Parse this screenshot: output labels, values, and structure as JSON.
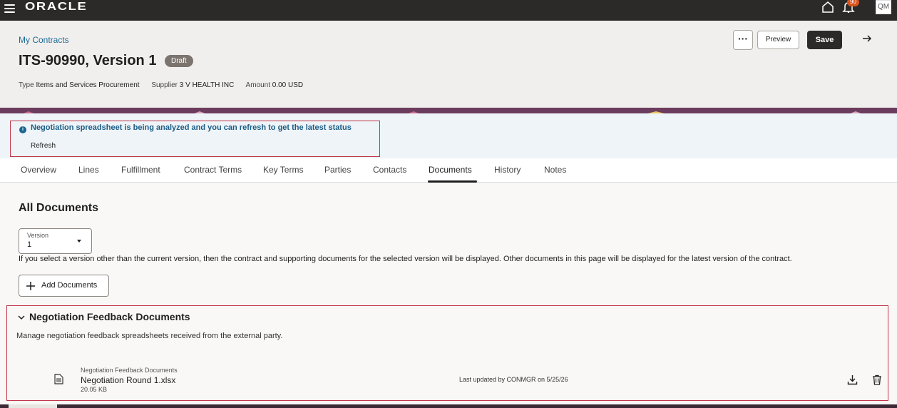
{
  "topbar": {
    "logo": "ORACLE",
    "notification_count": "90",
    "user_initials": "QM"
  },
  "header": {
    "breadcrumb": "My Contracts",
    "title": "ITS-90990, Version 1",
    "status": "Draft",
    "meta": {
      "type_label": "Type",
      "type_value": "Items and Services Procurement",
      "supplier_label": "Supplier",
      "supplier_value": "3 V HEALTH INC",
      "amount_label": "Amount",
      "amount_value": "0.00 USD"
    },
    "actions": {
      "more": "···",
      "preview": "Preview",
      "save": "Save"
    }
  },
  "message": {
    "text": "Negotiation spreadsheet is being analyzed and you can refresh to get the latest status",
    "action": "Refresh"
  },
  "tabs": [
    {
      "label": "Overview"
    },
    {
      "label": "Lines"
    },
    {
      "label": "Fulfillment"
    },
    {
      "label": "Contract Terms"
    },
    {
      "label": "Key Terms"
    },
    {
      "label": "Parties"
    },
    {
      "label": "Contacts"
    },
    {
      "label": "Documents"
    },
    {
      "label": "History"
    },
    {
      "label": "Notes"
    }
  ],
  "active_tab": "Documents",
  "main": {
    "heading": "All Documents",
    "version_select": {
      "label": "Version",
      "value": "1"
    },
    "version_help": "If you select a version other than the current version, then the contract and supporting documents for the selected version will be displayed. Other documents in this page will be displayed for the latest version of the contract.",
    "add_documents": "Add Documents"
  },
  "section": {
    "title": "Negotiation Feedback Documents",
    "description": "Manage negotiation feedback spreadsheets received from the external party.",
    "document": {
      "category": "Negotiation Feedback Documents",
      "name": "Negotiation Round 1.xlsx",
      "size": "20.05 KB",
      "updated": "Last updated by CONMGR on 5/25/26"
    }
  },
  "colors": {
    "topbar": "#2c2a28",
    "link": "#1c6b97",
    "highlight_border": "#c0364a",
    "band": "#6c3c5e"
  }
}
